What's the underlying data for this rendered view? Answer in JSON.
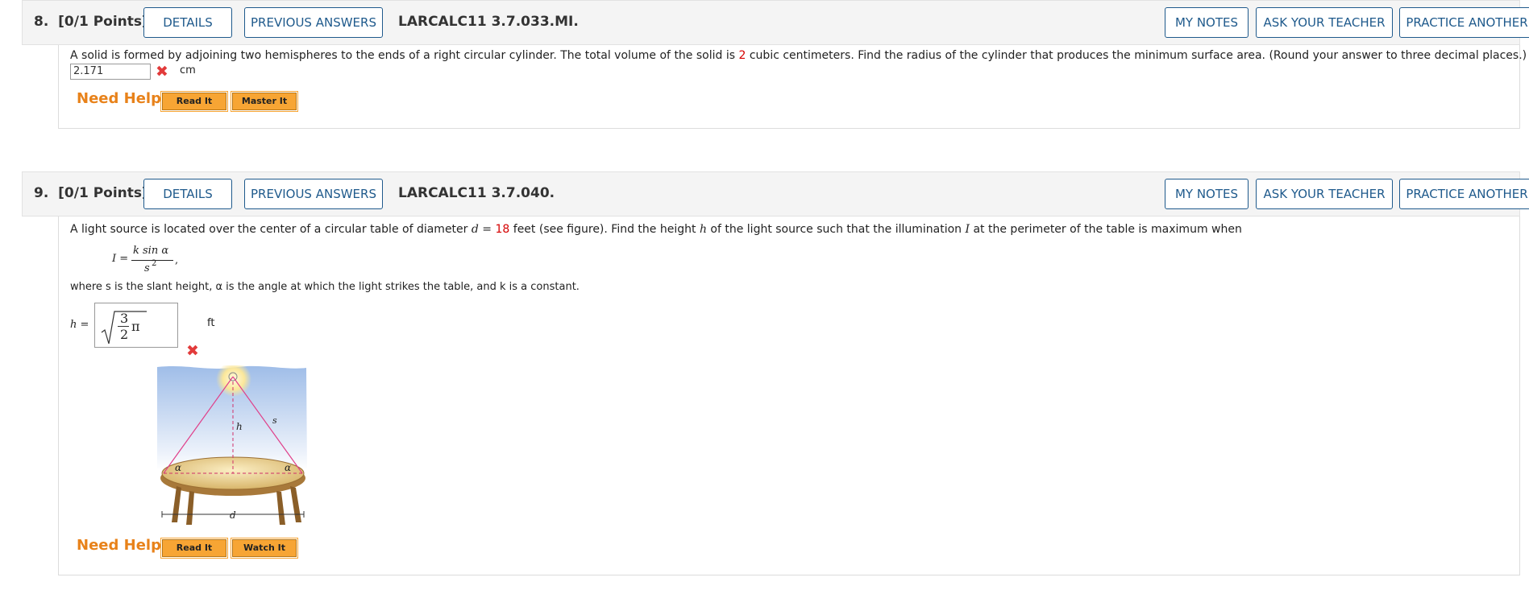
{
  "q8": {
    "number": "8.",
    "points": "[0/1 Points]",
    "details": "DETAILS",
    "previous": "PREVIOUS ANSWERS",
    "code": "LARCALC11 3.7.033.MI.",
    "my_notes": "MY NOTES",
    "ask": "ASK YOUR TEACHER",
    "practice": "PRACTICE ANOTHER",
    "text_before": "A solid is formed by adjoining two hemispheres to the ends of a right circular cylinder. The total volume of the solid is ",
    "volume": "2",
    "text_after": " cubic centimeters. Find the radius of the cylinder that produces the minimum surface area. (Round your answer to three decimal places.)",
    "answer": "2.171",
    "unit": "cm",
    "need_help": "Need Help?",
    "read_it": "Read It",
    "master_it": "Master It"
  },
  "q9": {
    "number": "9.",
    "points": "[0/1 Points]",
    "details": "DETAILS",
    "previous": "PREVIOUS ANSWERS",
    "code": "LARCALC11 3.7.040.",
    "my_notes": "MY NOTES",
    "ask": "ASK YOUR TEACHER",
    "practice": "PRACTICE ANOTHER",
    "text_a": "A light source is located over the center of a circular table of diameter ",
    "d_var": "d",
    "eq": " = ",
    "diameter": "18",
    "text_b": " feet (see figure). Find the height ",
    "h_var": "h",
    "text_c": " of the light source such that the illumination ",
    "i_var": "I",
    "text_d": " at the perimeter of the table is maximum when",
    "formula_lhs": "I =",
    "formula_num": "k sin α",
    "formula_den": "s",
    "formula_exp": "2",
    "formula_comma": ",",
    "where_text": "where s is the slant height, α is the angle at which the light strikes the table, and k is a constant.",
    "h_label": "h =",
    "frac_num": "3",
    "frac_den": "2",
    "pi": "π",
    "unit": "ft",
    "fig_h": "h",
    "fig_s": "s",
    "fig_d": "d",
    "fig_alpha": "α",
    "need_help": "Need Help?",
    "read_it": "Read It",
    "watch_it": "Watch It"
  }
}
